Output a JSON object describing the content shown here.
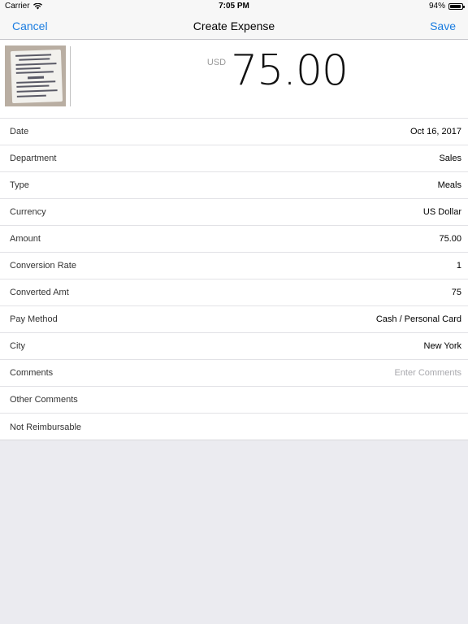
{
  "status": {
    "carrier": "Carrier",
    "time": "7:05 PM",
    "battery": "94%",
    "battery_level": 0.94
  },
  "nav": {
    "cancel": "Cancel",
    "title": "Create Expense",
    "save": "Save"
  },
  "amount": {
    "currency": "USD",
    "value": "75.00"
  },
  "fields": [
    {
      "label": "Date",
      "value": "Oct 16, 2017"
    },
    {
      "label": "Department",
      "value": "Sales"
    },
    {
      "label": "Type",
      "value": "Meals"
    },
    {
      "label": "Currency",
      "value": "US Dollar"
    },
    {
      "label": "Amount",
      "value": "75.00"
    },
    {
      "label": "Conversion Rate",
      "value": "1"
    },
    {
      "label": "Converted Amt",
      "value": "75"
    },
    {
      "label": "Pay Method",
      "value": "Cash / Personal Card"
    },
    {
      "label": "City",
      "value": "New York"
    },
    {
      "label": "Comments",
      "placeholder": "Enter Comments"
    },
    {
      "label": "Other Comments",
      "value": ""
    },
    {
      "label": "Not Reimbursable",
      "value": ""
    }
  ],
  "colors": {
    "accent": "#1a7ce0",
    "background": "#ebebf0",
    "bar": "#f7f7f7"
  }
}
